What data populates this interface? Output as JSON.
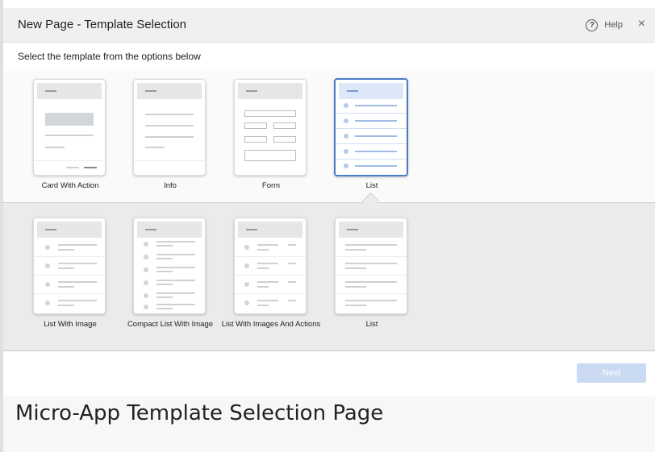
{
  "dialog": {
    "title": "New Page - Template Selection",
    "help_icon": "question-circle-icon",
    "help_icon_glyph": "?",
    "help_label": "Help",
    "close_icon": "close-icon",
    "close_glyph": "×",
    "instruction": "Select the template from the options below"
  },
  "templates": [
    {
      "label": "Card With Action"
    },
    {
      "label": "Info"
    },
    {
      "label": "Form"
    },
    {
      "label": "List",
      "selected": true
    }
  ],
  "sub_templates": [
    {
      "label": "List With Image"
    },
    {
      "label": "Compact List With Image"
    },
    {
      "label": "List With Images And Actions"
    },
    {
      "label": "List"
    }
  ],
  "footer": {
    "next_label": "Next"
  },
  "caption": "Micro-App Template Selection Page",
  "colors": {
    "accent": "#4a7cc9",
    "next_button_disabled": "#c9daf2"
  }
}
